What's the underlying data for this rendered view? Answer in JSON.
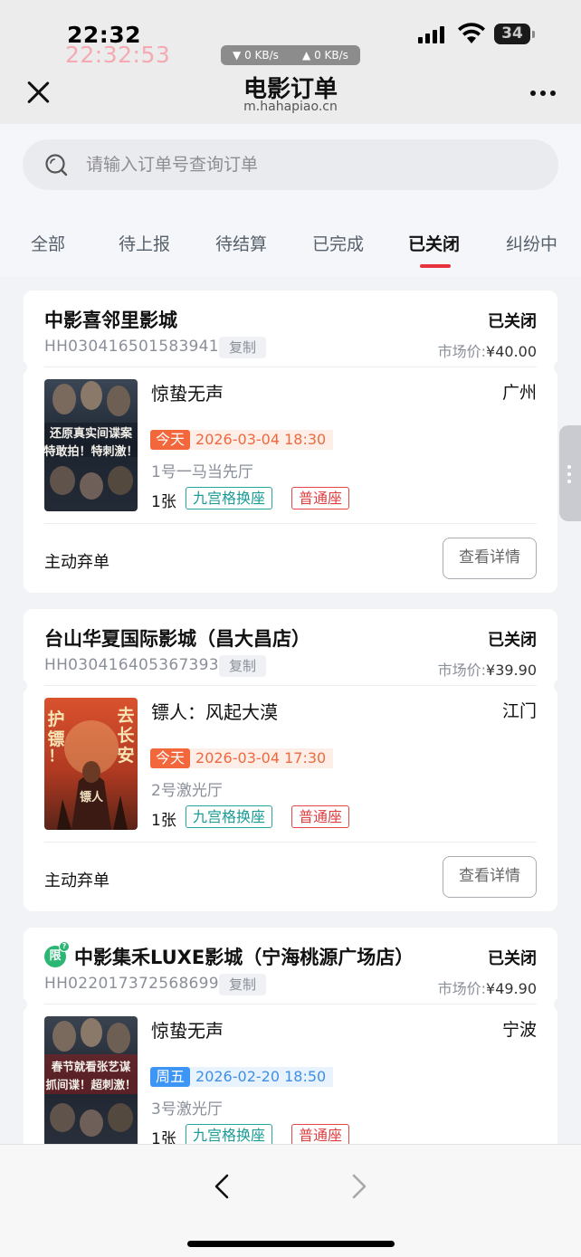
{
  "status_bar": {
    "time": "22:32",
    "time_overlay": "22:32:53",
    "download_speed": "▼ 0 KB/s",
    "upload_speed": "▲ 0 KB/s",
    "battery": "34"
  },
  "header": {
    "title": "电影订单",
    "subtitle": "m.hahapiao.cn"
  },
  "search": {
    "placeholder": "请输入订单号查询订单"
  },
  "tabs": [
    {
      "label": "全部"
    },
    {
      "label": "待上报"
    },
    {
      "label": "待结算"
    },
    {
      "label": "已完成"
    },
    {
      "label": "已关闭",
      "active": true
    },
    {
      "label": "纠纷中"
    }
  ],
  "orders": [
    {
      "cinema": "中影喜邻里影城",
      "status": "已关闭",
      "order_no": "HH030416501583941",
      "copy_label": "复制",
      "price_label": "市场价:",
      "price": "¥40.00",
      "movie": "惊蛰无声",
      "city": "广州",
      "day": "今天",
      "datetime": "2026-03-04 18:30",
      "hall": "1号一马当先厅",
      "qty": "1张",
      "tag1": "九宫格换座",
      "tag2": "普通座",
      "abandon_label": "主动弃单",
      "detail_label": "查看详情",
      "poster_lines": [
        "还原真实间谍案",
        "特敢拍！特刺激！"
      ]
    },
    {
      "cinema": "台山华夏国际影城（昌大昌店）",
      "status": "已关闭",
      "order_no": "HH030416405367393",
      "copy_label": "复制",
      "price_label": "市场价:",
      "price": "¥39.90",
      "movie": "镖人：风起大漠",
      "city": "江门",
      "day": "今天",
      "datetime": "2026-03-04 17:30",
      "hall": "2号激光厅",
      "qty": "1张",
      "tag1": "九宫格换座",
      "tag2": "普通座",
      "abandon_label": "主动弃单",
      "detail_label": "查看详情",
      "poster_lines": [
        "护镖！",
        "去长安",
        "镖人"
      ]
    },
    {
      "badge": "限",
      "badge_sup": "?",
      "cinema": "中影集禾LUXE影城（宁海桃源广场店）",
      "status": "已关闭",
      "order_no": "HH022017372568699",
      "copy_label": "复制",
      "price_label": "市场价:",
      "price": "¥49.90",
      "movie": "惊蛰无声",
      "city": "宁波",
      "day": "周五",
      "datetime": "2026-02-20 18:50",
      "hall": "3号激光厅",
      "qty": "1张",
      "tag1": "九宫格换座",
      "tag2": "普通座",
      "poster_lines": [
        "春节就看张艺谋",
        "抓间谍！超刺激！"
      ]
    }
  ],
  "colors": {
    "accent_red": "#e8333e",
    "today_orange": "#f2673c",
    "weekday_blue": "#3d95f5",
    "tag_teal": "#25a5a0",
    "tag_red": "#e5474a"
  }
}
